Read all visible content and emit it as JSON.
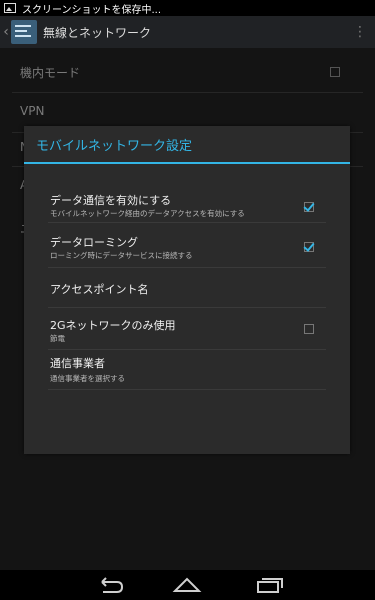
{
  "statusbar": {
    "notification_text": "スクリーンショットを保存中..."
  },
  "actionbar": {
    "title": "無線とネットワーク",
    "back_glyph": "‹",
    "overflow_glyph": "⋮"
  },
  "background_list": {
    "items": [
      {
        "label": "機内モード"
      },
      {
        "label": "VPN"
      },
      {
        "label": "N"
      },
      {
        "label": "A"
      },
      {
        "label": "ニ"
      }
    ]
  },
  "dialog": {
    "title": "モバイルネットワーク設定",
    "options": [
      {
        "label": "データ通信を有効にする",
        "summary": "モバイルネットワーク経由のデータアクセスを有効にする",
        "checkbox": true,
        "checked": true
      },
      {
        "label": "データローミング",
        "summary": "ローミング時にデータサービスに接続する",
        "checkbox": true,
        "checked": true
      },
      {
        "label": "アクセスポイント名",
        "summary": "",
        "checkbox": false
      },
      {
        "label": "2Gネットワークのみ使用",
        "summary": "節電",
        "checkbox": true,
        "checked": false
      },
      {
        "label": "通信事業者",
        "summary": "通信事業者を選択する",
        "checkbox": false
      }
    ]
  },
  "colors": {
    "accent": "#33b5e5",
    "dialog_bg": "#2b2b2b",
    "screen_bg": "#141414"
  },
  "navbar": {
    "icons": [
      "back-icon",
      "home-icon",
      "recent-apps-icon"
    ]
  }
}
